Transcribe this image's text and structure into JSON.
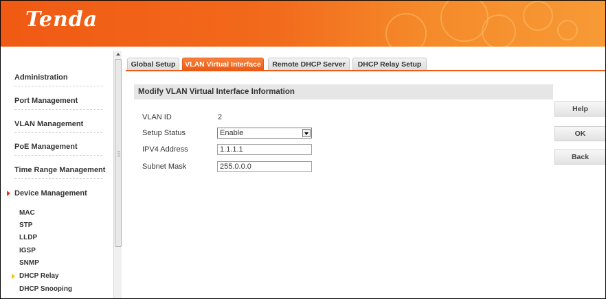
{
  "header": {
    "logo": "Tenda"
  },
  "sidebar": {
    "items": [
      {
        "label": "Administration"
      },
      {
        "label": "Port Management"
      },
      {
        "label": "VLAN Management"
      },
      {
        "label": "PoE Management"
      },
      {
        "label": "Time Range Management"
      },
      {
        "label": "Device Management",
        "active": true
      }
    ],
    "sub_items": [
      {
        "label": "MAC"
      },
      {
        "label": "STP"
      },
      {
        "label": "LLDP"
      },
      {
        "label": "IGSP"
      },
      {
        "label": "SNMP"
      },
      {
        "label": "DHCP Relay",
        "active": true
      },
      {
        "label": "DHCP Snooping"
      }
    ]
  },
  "tabs": [
    {
      "label": "Global Setup"
    },
    {
      "label": "VLAN Virtual Interface",
      "active": true
    },
    {
      "label": "Remote DHCP Server"
    },
    {
      "label": "DHCP Relay Setup"
    }
  ],
  "panel": {
    "title": "Modify VLAN Virtual Interface Information",
    "vlan_id_label": "VLAN ID",
    "vlan_id_value": "2",
    "setup_status_label": "Setup Status",
    "setup_status_value": "Enable",
    "ipv4_label": "IPV4 Address",
    "ipv4_value": "1.1.1.1",
    "mask_label": "Subnet Mask",
    "mask_value": "255.0.0.0"
  },
  "buttons": {
    "help": "Help",
    "ok": "OK",
    "back": "Back"
  },
  "colors": {
    "brand": "#f05a14",
    "active_tab": "#ee5b14",
    "nav_arrow": "#e5331b",
    "sub_arrow": "#f3c326"
  }
}
